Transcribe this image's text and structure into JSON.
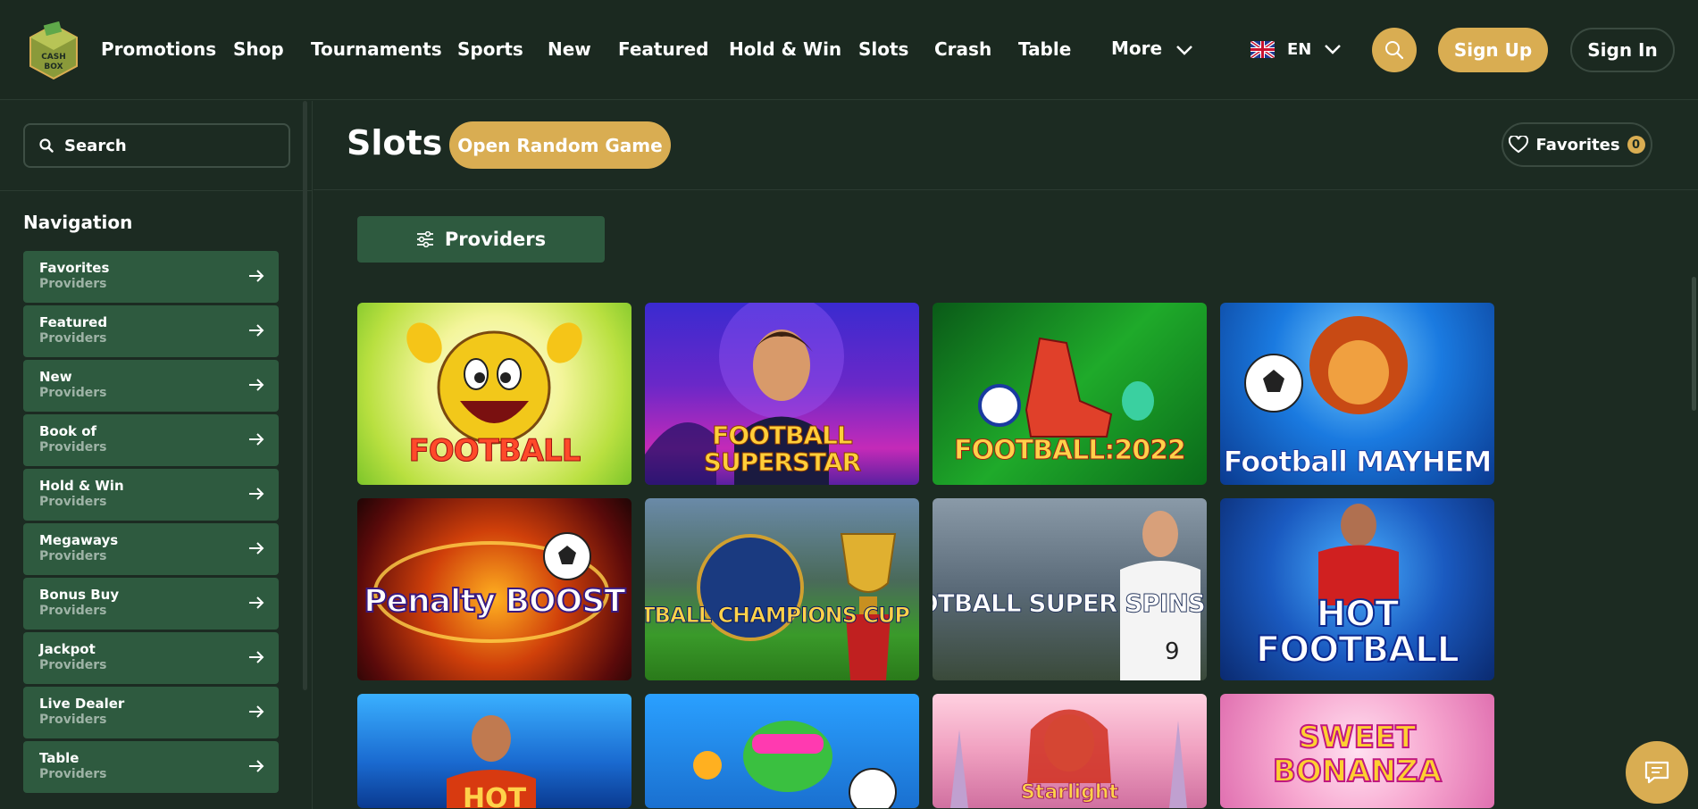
{
  "brand": {
    "logo_text": "CASH BOX"
  },
  "nav": {
    "items": [
      "Promotions",
      "Shop",
      "Tournaments",
      "Sports",
      "New",
      "Featured",
      "Hold & Win",
      "Slots",
      "Crash",
      "Table"
    ],
    "more_label": "More"
  },
  "header": {
    "language": "EN",
    "signup_label": "Sign Up",
    "signin_label": "Sign In"
  },
  "sidebar": {
    "search_placeholder": "Search",
    "heading": "Navigation",
    "items": [
      {
        "label": "Favorites",
        "sub": "Providers"
      },
      {
        "label": "Featured",
        "sub": "Providers"
      },
      {
        "label": "New",
        "sub": "Providers"
      },
      {
        "label": "Book of",
        "sub": "Providers"
      },
      {
        "label": "Hold & Win",
        "sub": "Providers"
      },
      {
        "label": "Megaways",
        "sub": "Providers"
      },
      {
        "label": "Bonus Buy",
        "sub": "Providers"
      },
      {
        "label": "Jackpot",
        "sub": "Providers"
      },
      {
        "label": "Live Dealer",
        "sub": "Providers"
      },
      {
        "label": "Table",
        "sub": "Providers"
      }
    ]
  },
  "main": {
    "title": "Slots",
    "random_label": "Open Random Game",
    "favorites_label": "Favorites",
    "favorites_count": "0",
    "providers_label": "Providers"
  },
  "games": [
    {
      "title": "FOOTBALL"
    },
    {
      "title": "FOOTBALL SUPERSTAR"
    },
    {
      "title": "FOOTBALL:2022"
    },
    {
      "title": "Football MAYHEM"
    },
    {
      "title": "Penalty BOOST"
    },
    {
      "title": "FOOTBALL CHAMPIONS CUP"
    },
    {
      "title": "FOOTBALL SUPER SPINS"
    },
    {
      "title": "HOT FOOTBALL"
    },
    {
      "title": "HOT"
    },
    {
      "title": ""
    },
    {
      "title": "Starlight"
    },
    {
      "title": "SWEET BONANZA"
    }
  ],
  "colors": {
    "background": "#1c2b22",
    "accent_gold": "#d9ad52",
    "sidebar_item": "#2e5a3f",
    "sub_text": "#9eb3a6"
  }
}
